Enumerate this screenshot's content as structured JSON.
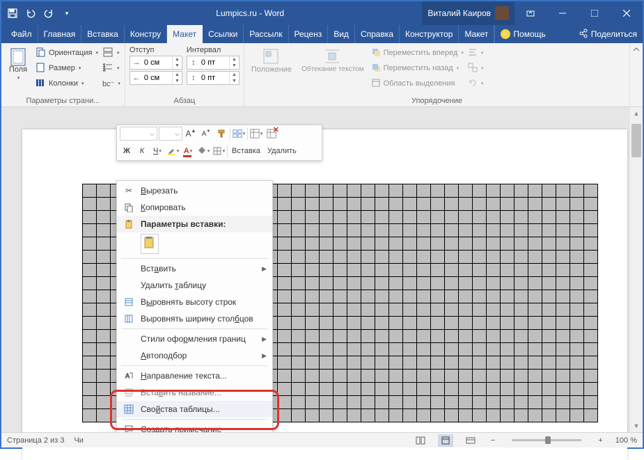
{
  "title": "Lumpics.ru  -  Word",
  "user": "Виталий Каиров",
  "menu": {
    "file": "Файл",
    "home": "Главная",
    "insert": "Вставка",
    "design": "Констру",
    "layout": "Макет",
    "refs": "Ссылки",
    "mail": "Рассылк",
    "review": "Реценз",
    "view": "Вид",
    "help": "Справка",
    "table_design": "Конструктор",
    "table_layout": "Макет",
    "help_btn": "Помощь",
    "share": "Поделиться"
  },
  "ribbon": {
    "page": {
      "fields": "Поля",
      "orientation": "Ориентация",
      "size": "Размер",
      "columns": "Колонки",
      "caption": "Параметры страни..."
    },
    "indent": {
      "label": "Отступ",
      "left": "0 см",
      "right": "0 см"
    },
    "spacing": {
      "label": "Интервал",
      "before": "0 пт",
      "after": "0 пт"
    },
    "paragraph_caption": "Абзац",
    "position": "Положение",
    "wrap": "Обтекание текстом",
    "bring_forward": "Переместить вперед",
    "send_backward": "Переместить назад",
    "selection_pane": "Область выделения",
    "arrange_caption": "Упорядочение"
  },
  "float_toolbar": {
    "insert": "Вставка",
    "delete": "Удалить"
  },
  "context": {
    "cut": "Вырезать",
    "copy": "Копировать",
    "paste_options": "Параметры вставки:",
    "insert": "Вставить",
    "delete_table": "Удалить таблицу",
    "dist_rows": "Выровнять высоту строк",
    "dist_cols": "Выровнять ширину столбцов",
    "border_styles": "Стили оформления границ",
    "autofit": "Автоподбор",
    "text_direction": "Направление текста...",
    "insert_caption": "Вставить название...",
    "table_props": "Свойства таблицы...",
    "new_comment": "Создать примечание"
  },
  "status": {
    "page": "Страница 2 из 3",
    "words": "Чи",
    "zoom": "100 %"
  }
}
